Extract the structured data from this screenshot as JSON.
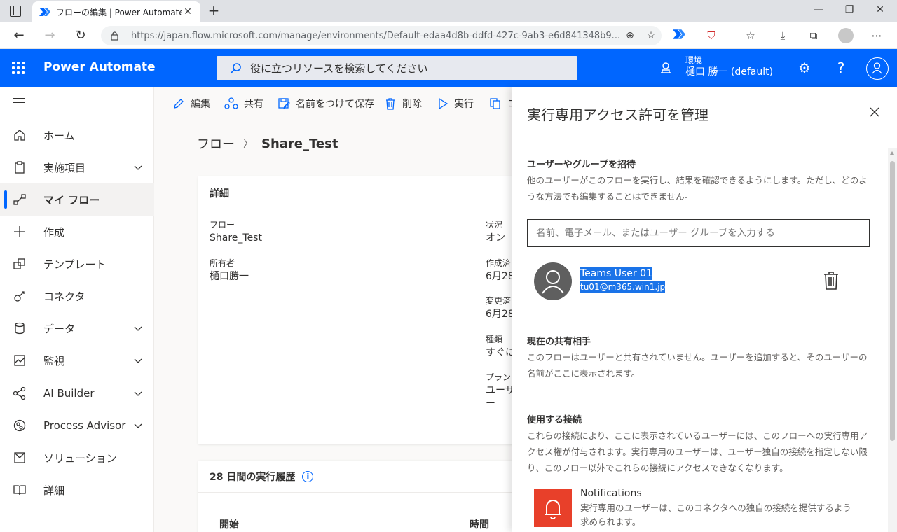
{
  "browser": {
    "tab_title": "フローの編集 | Power Automate",
    "url": "https://japan.flow.microsoft.com/manage/environments/Default-edaa4d8b-ddfd-427c-9ab3-e6d841348b9..."
  },
  "app": {
    "brand": "Power Automate",
    "search_placeholder": "役に立つリソースを検索してください",
    "env_label": "環境",
    "env_value": "樋口 勝一 (default)",
    "accent_color": "#0066ff"
  },
  "nav": {
    "items": [
      {
        "label": "ホーム",
        "icon": "home-icon"
      },
      {
        "label": "実施項目",
        "icon": "clipboard-icon"
      },
      {
        "label": "マイ フロー",
        "icon": "flow-icon"
      },
      {
        "label": "作成",
        "icon": "plus-icon"
      },
      {
        "label": "テンプレート",
        "icon": "template-icon"
      },
      {
        "label": "コネクタ",
        "icon": "connector-icon"
      },
      {
        "label": "データ",
        "icon": "database-icon"
      },
      {
        "label": "監視",
        "icon": "monitor-icon"
      },
      {
        "label": "AI Builder",
        "icon": "ai-builder-icon"
      },
      {
        "label": "Process Advisor",
        "icon": "process-advisor-icon"
      },
      {
        "label": "ソリューション",
        "icon": "solution-icon"
      },
      {
        "label": "詳細",
        "icon": "book-icon"
      }
    ]
  },
  "commands": {
    "edit": "編集",
    "share": "共有",
    "save_as": "名前をつけて保存",
    "delete": "削除",
    "run": "実行",
    "copy_partial": "コ"
  },
  "breadcrumb": {
    "root": "フロー",
    "current": "Share_Test"
  },
  "details": {
    "title": "詳細",
    "flow_label": "フロー",
    "flow_value": "Share_Test",
    "owner_label": "所有者",
    "owner_value": "樋口勝一",
    "status_label": "状況",
    "status_value": "オン",
    "created_label": "作成済",
    "created_value": "6月28",
    "modified_label": "変更済",
    "modified_value": "6月28",
    "type_label": "種類",
    "type_value": "すぐに",
    "plan_label": "プラン",
    "plan_value": "ユーザー"
  },
  "history": {
    "title": "28 日間の実行履歴",
    "col_start": "開始",
    "col_time": "時間"
  },
  "panel": {
    "title": "実行専用アクセス許可を管理",
    "invite_heading": "ユーザーやグループを招待",
    "invite_desc": "他のユーザーがこのフローを実行し、結果を確認できるようにします。ただし、どのような方法でも編集することはできません。",
    "invite_placeholder": "名前、電子メール、またはユーザー グループを入力する",
    "user_name": "Teams User 01",
    "user_email": "tu01@m365.win1.jp",
    "shared_heading": "現在の共有相手",
    "shared_desc": "このフローはユーザーと共有されていません。ユーザーを追加すると、そのユーザーの名前がここに表示されます。",
    "connections_heading": "使用する接続",
    "connections_desc": "これらの接続により、ここに表示されているユーザーには、このフローへの実行専用アクセス権が付与されます。実行専用のユーザーは、ユーザー独自の接続を指定しない限り、このフロー以外でこれらの接続にアクセスできなくなります。",
    "connector_name": "Notifications",
    "connector_desc": "実行専用のユーザーは、このコネクタへの独自の接続を提供するよう求められます。"
  }
}
